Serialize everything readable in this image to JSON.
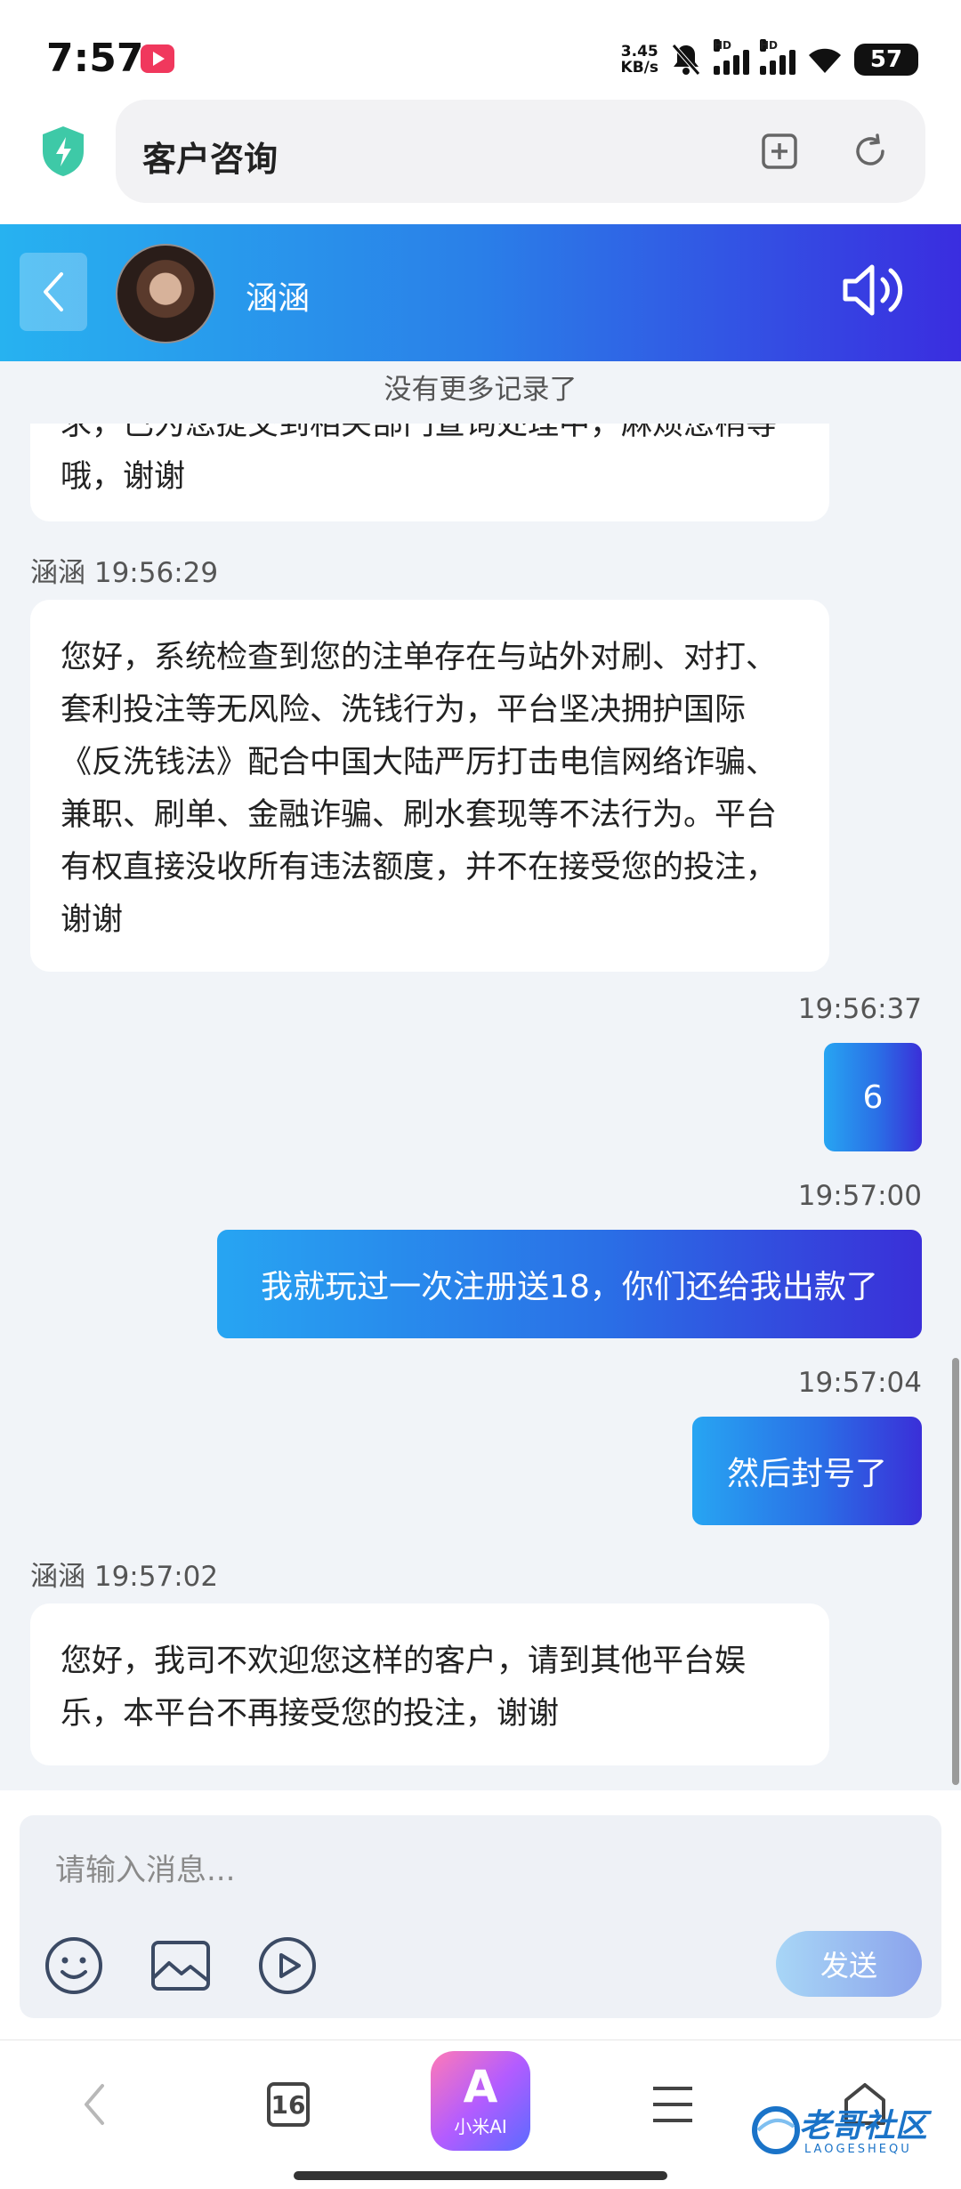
{
  "status_bar": {
    "time": "7:57",
    "net_speed_value": "3.45",
    "net_speed_unit": "KB/s",
    "hd_label": "HD",
    "battery": "57"
  },
  "browser": {
    "page_title": "客户咨询",
    "tab_count": "16",
    "ai_label": "小米AI",
    "ai_glyph": "A"
  },
  "chat": {
    "agent_name": "涵涵",
    "no_more_records": "没有更多记录了",
    "messages": [
      {
        "side": "in",
        "text": "求，已为您提交到相关部门查询处理中，麻烦您稍等哦，谢谢",
        "partial": true
      },
      {
        "side": "in",
        "sender": "涵涵",
        "time": "19:56:29",
        "text": "您好，系统检查到您的注单存在与站外对刷、对打、套利投注等无风险、洗钱行为，平台坚决拥护国际《反洗钱法》配合中国大陆严厉打击电信网络诈骗、兼职、刷单、金融诈骗、刷水套现等不法行为。平台有权直接没收所有违法额度，并不在接受您的投注，谢谢"
      },
      {
        "side": "out",
        "time": "19:56:37",
        "text": "6"
      },
      {
        "side": "out",
        "time": "19:57:00",
        "text": "我就玩过一次注册送18，你们还给我出款了"
      },
      {
        "side": "out",
        "time": "19:57:04",
        "text": "然后封号了"
      },
      {
        "side": "in",
        "sender": "涵涵",
        "time": "19:57:02",
        "text": "您好，我司不欢迎您这样的客户，请到其他平台娱乐，本平台不再接受您的投注，谢谢"
      }
    ]
  },
  "composer": {
    "placeholder": "请输入消息...",
    "send_label": "发送"
  },
  "watermark": {
    "main": "老哥社区",
    "sub": "LAOGESHEQU"
  },
  "colors": {
    "header_gradient_start": "#27b2f0",
    "header_gradient_end": "#3a2de0",
    "chat_background": "#f1f4f8",
    "shield_green": "#3ec9a7"
  }
}
